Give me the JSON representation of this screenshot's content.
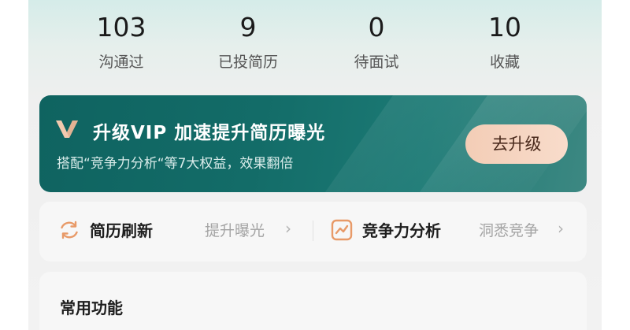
{
  "stats": [
    {
      "value": "103",
      "label": "沟通过"
    },
    {
      "value": "9",
      "label": "已投简历"
    },
    {
      "value": "0",
      "label": "待面试"
    },
    {
      "value": "10",
      "label": "收藏"
    }
  ],
  "vip_banner": {
    "title": "升级VIP 加速提升简历曝光",
    "subtitle": "搭配“竞争力分析“等7大权益，效果翻倍",
    "button_label": "去升级",
    "colors": {
      "banner": "#136c68",
      "button": "#f5d3bf",
      "icon": "#f2c9ae"
    }
  },
  "tools": {
    "refresh": {
      "title": "简历刷新",
      "desc": "提升曝光",
      "chevron": "›",
      "icon": "refresh-icon"
    },
    "analysis": {
      "title": "竞争力分析",
      "desc": "洞悉竞争",
      "chevron": "›",
      "icon": "chart-icon"
    },
    "icon_color": "#e89a68"
  },
  "common_functions": {
    "title": "常用功能"
  }
}
